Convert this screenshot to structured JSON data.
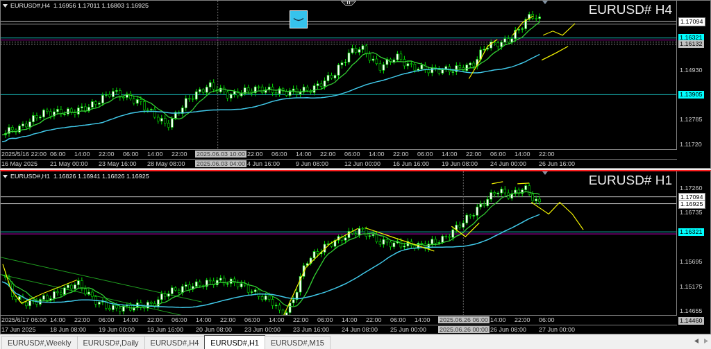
{
  "charts": [
    {
      "header": "EURUSD#,H4  1.16956 1.17011 1.16803 1.16925",
      "title": "EURUSD# H4",
      "active": false,
      "price_labels": [
        {
          "text": "1.17094",
          "kind": "white"
        },
        {
          "text": "1.16321",
          "kind": "cyan"
        },
        {
          "text": "1.16132",
          "kind": "gray"
        },
        {
          "text": "1.14930",
          "kind": "tick"
        },
        {
          "text": "1.13905",
          "kind": "cyan"
        },
        {
          "text": "1.12785",
          "kind": "tick"
        },
        {
          "text": "1.11720",
          "kind": "tick"
        }
      ],
      "time_row_1": [
        {
          "text": "2025/5/16 22:00",
          "highlighted": false
        },
        {
          "text": "06:00",
          "highlighted": false
        },
        {
          "text": "14:00",
          "highlighted": false
        },
        {
          "text": "22:00",
          "highlighted": false
        },
        {
          "text": "06:00",
          "highlighted": false
        },
        {
          "text": "14:00",
          "highlighted": false
        },
        {
          "text": "22:00",
          "highlighted": false
        },
        {
          "text": "2025.06.03 10:00",
          "highlighted": true
        },
        {
          "text": "22:00",
          "highlighted": false
        },
        {
          "text": "06:00",
          "highlighted": false
        },
        {
          "text": "14:00",
          "highlighted": false
        },
        {
          "text": "22:00",
          "highlighted": false
        },
        {
          "text": "06:00",
          "highlighted": false
        },
        {
          "text": "14:00",
          "highlighted": false
        },
        {
          "text": "22:00",
          "highlighted": false
        },
        {
          "text": "06:00",
          "highlighted": false
        },
        {
          "text": "14:00",
          "highlighted": false
        },
        {
          "text": "22:00",
          "highlighted": false
        },
        {
          "text": "06:00",
          "highlighted": false
        },
        {
          "text": "14:00",
          "highlighted": false
        },
        {
          "text": "22:00",
          "highlighted": false
        }
      ],
      "time_row_2": [
        {
          "text": "16 May 2025",
          "highlighted": false
        },
        {
          "text": "21 May 00:00",
          "highlighted": false
        },
        {
          "text": "23 May 16:00",
          "highlighted": false
        },
        {
          "text": "28 May 08:00",
          "highlighted": false
        },
        {
          "text": "2025.06.03 04:00",
          "highlighted": true
        },
        {
          "text": "4 Jun 16:00",
          "highlighted": false
        },
        {
          "text": "9 Jun 08:00",
          "highlighted": false
        },
        {
          "text": "12 Jun 00:00",
          "highlighted": false
        },
        {
          "text": "16 Jun 16:00",
          "highlighted": false
        },
        {
          "text": "19 Jun 08:00",
          "highlighted": false
        },
        {
          "text": "24 Jun 00:00",
          "highlighted": false
        },
        {
          "text": "26 Jun 16:00",
          "highlighted": false
        }
      ]
    },
    {
      "header": "EURUSD#,H1  1.16826 1.16941 1.16826 1.16925",
      "title": "EURUSD# H1",
      "active": true,
      "price_labels": [
        {
          "text": "1.17260",
          "kind": "tick"
        },
        {
          "text": "1.17094",
          "kind": "white"
        },
        {
          "text": "1.16925",
          "kind": "white"
        },
        {
          "text": "1.16735",
          "kind": "tick"
        },
        {
          "text": "1.16321",
          "kind": "cyan"
        },
        {
          "text": "1.15695",
          "kind": "tick"
        },
        {
          "text": "1.15175",
          "kind": "tick"
        },
        {
          "text": "1.14655",
          "kind": "tick"
        },
        {
          "text": "1.14460",
          "kind": "gray"
        }
      ],
      "time_row_1": [
        {
          "text": "2025/6/17 06:00",
          "highlighted": false
        },
        {
          "text": "14:00",
          "highlighted": false
        },
        {
          "text": "22:00",
          "highlighted": false
        },
        {
          "text": "06:00",
          "highlighted": false
        },
        {
          "text": "14:00",
          "highlighted": false
        },
        {
          "text": "22:00",
          "highlighted": false
        },
        {
          "text": "06:00",
          "highlighted": false
        },
        {
          "text": "14:00",
          "highlighted": false
        },
        {
          "text": "22:00",
          "highlighted": false
        },
        {
          "text": "06:00",
          "highlighted": false
        },
        {
          "text": "14:00",
          "highlighted": false
        },
        {
          "text": "22:00",
          "highlighted": false
        },
        {
          "text": "06:00",
          "highlighted": false
        },
        {
          "text": "14:00",
          "highlighted": false
        },
        {
          "text": "22:00",
          "highlighted": false
        },
        {
          "text": "06:00",
          "highlighted": false
        },
        {
          "text": "14:00",
          "highlighted": false
        },
        {
          "text": "2025.06.26 06:00",
          "highlighted": true
        },
        {
          "text": "14:00",
          "highlighted": false
        },
        {
          "text": "22:00",
          "highlighted": false
        },
        {
          "text": "06:00",
          "highlighted": false
        }
      ],
      "time_row_2": [
        {
          "text": "17 Jun 2025",
          "highlighted": false
        },
        {
          "text": "18 Jun 08:00",
          "highlighted": false
        },
        {
          "text": "19 Jun 00:00",
          "highlighted": false
        },
        {
          "text": "19 Jun 16:00",
          "highlighted": false
        },
        {
          "text": "20 Jun 08:00",
          "highlighted": false
        },
        {
          "text": "23 Jun 00:00",
          "highlighted": false
        },
        {
          "text": "23 Jun 16:00",
          "highlighted": false
        },
        {
          "text": "24 Jun 08:00",
          "highlighted": false
        },
        {
          "text": "25 Jun 00:00",
          "highlighted": false
        },
        {
          "text": "2025.06.26 00:00",
          "highlighted": true
        },
        {
          "text": "26 Jun 08:00",
          "highlighted": false
        },
        {
          "text": "27 Jun 00:00",
          "highlighted": false
        }
      ]
    }
  ],
  "tabs": [
    {
      "label": "EURUSD#,Weekly",
      "selected": false
    },
    {
      "label": "EURUSD#,Daily",
      "selected": false
    },
    {
      "label": "EURUSD#,H4",
      "selected": false
    },
    {
      "label": "EURUSD#,H1",
      "selected": true
    },
    {
      "label": "EURUSD#,M15",
      "selected": false
    }
  ]
}
